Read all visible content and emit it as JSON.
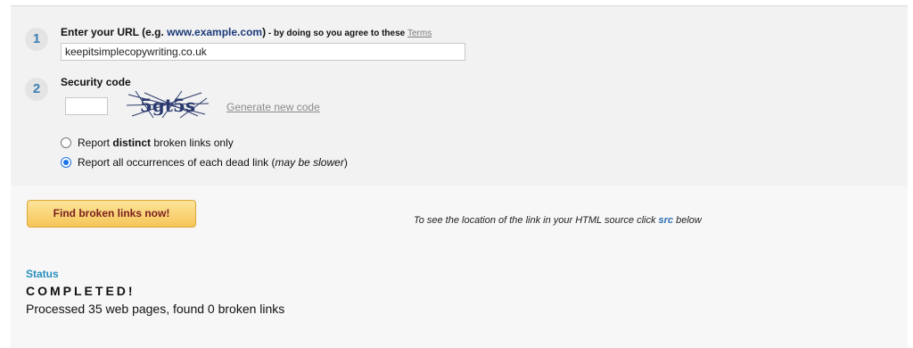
{
  "step1": {
    "number": "1",
    "label_prefix": "Enter your URL (e.g. ",
    "label_example": "www.example.com",
    "label_suffix": ")",
    "note": " - by doing so you agree to these ",
    "terms_link": "Terms",
    "url_value": "keepitsimplecopywriting.co.uk"
  },
  "step2": {
    "number": "2",
    "label": "Security code",
    "code_value": "",
    "captcha_text": "5gt5s",
    "generate_link": "Generate new code"
  },
  "options": {
    "distinct": {
      "before": "Report ",
      "bold": "distinct",
      "after": " broken links only",
      "checked": false
    },
    "all": {
      "before": "Report all occurrences of each dead link (",
      "italic": "may be slower",
      "after": ")",
      "checked": true
    }
  },
  "action": {
    "button_label": "Find broken links now!",
    "hint_before": "To see the location of the link in your HTML source click ",
    "hint_src": "src",
    "hint_after": " below"
  },
  "status": {
    "label": "Status",
    "value": "COMPLETED!",
    "detail": "Processed 35 web pages, found 0 broken links"
  },
  "colors": {
    "step_number": "#3c7fb1",
    "status_label": "#2a8fbd",
    "button_text": "#7a1e1e",
    "radio_checked": "#1a73e8"
  }
}
